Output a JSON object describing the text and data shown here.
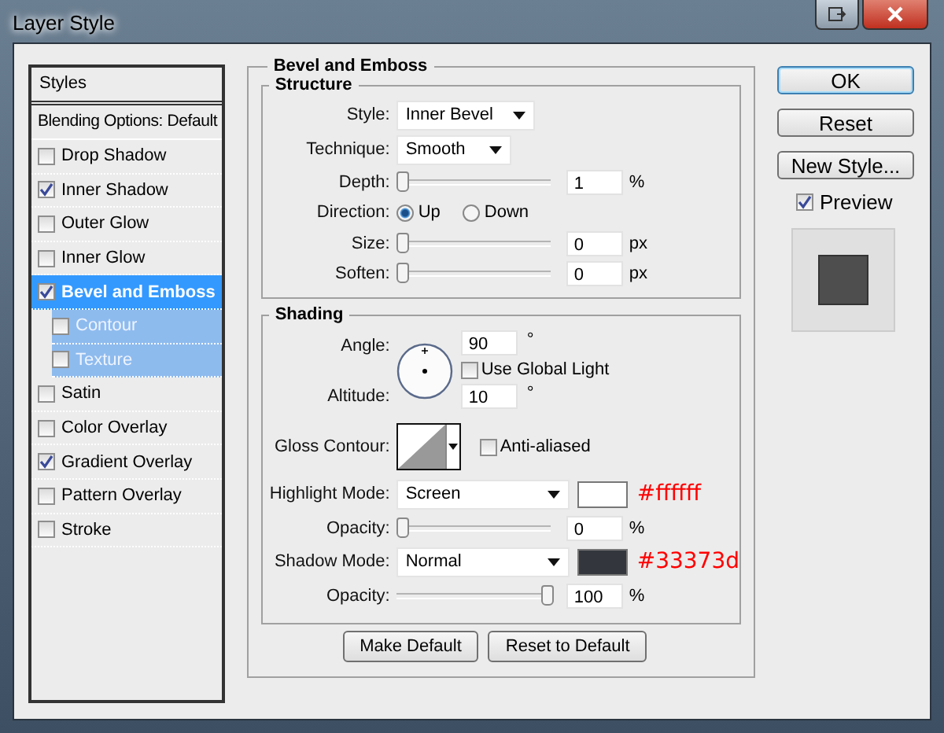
{
  "window": {
    "title": "Layer Style"
  },
  "styles_panel": {
    "header": "Styles",
    "blending_options": "Blending Options: Default",
    "items": [
      {
        "label": "Drop Shadow",
        "checked": false,
        "selected": false
      },
      {
        "label": "Inner Shadow",
        "checked": true,
        "selected": false
      },
      {
        "label": "Outer Glow",
        "checked": false,
        "selected": false
      },
      {
        "label": "Inner Glow",
        "checked": false,
        "selected": false
      },
      {
        "label": "Bevel and Emboss",
        "checked": true,
        "selected": true,
        "children": [
          {
            "label": "Contour",
            "checked": false,
            "selected": false
          },
          {
            "label": "Texture",
            "checked": false,
            "selected": false
          }
        ]
      },
      {
        "label": "Satin",
        "checked": false,
        "selected": false
      },
      {
        "label": "Color Overlay",
        "checked": false,
        "selected": false
      },
      {
        "label": "Gradient Overlay",
        "checked": true,
        "selected": false
      },
      {
        "label": "Pattern Overlay",
        "checked": false,
        "selected": false
      },
      {
        "label": "Stroke",
        "checked": false,
        "selected": false
      }
    ]
  },
  "bevel_and_emboss": {
    "title": "Bevel and Emboss",
    "structure": {
      "title": "Structure",
      "style": {
        "label": "Style:",
        "value": "Inner Bevel"
      },
      "technique": {
        "label": "Technique:",
        "value": "Smooth"
      },
      "depth": {
        "label": "Depth:",
        "level": 0,
        "value": "1",
        "unit": "%"
      },
      "direction": {
        "label": "Direction:",
        "options": [
          {
            "label": "Up",
            "selected": true
          },
          {
            "label": "Down",
            "selected": false
          }
        ]
      },
      "size": {
        "label": "Size:",
        "level": 0,
        "value": "0",
        "unit": "px"
      },
      "soften": {
        "label": "Soften:",
        "level": 0,
        "value": "0",
        "unit": "px"
      }
    },
    "shading": {
      "title": "Shading",
      "angle": {
        "label": "Angle:",
        "value": "90",
        "unit": "°"
      },
      "use_global_light": {
        "label": "Use Global Light",
        "checked": false
      },
      "altitude": {
        "label": "Altitude:",
        "value": "10",
        "unit": "°"
      },
      "gloss_contour": {
        "label": "Gloss Contour:"
      },
      "anti_aliased": {
        "label": "Anti-aliased",
        "checked": false
      },
      "highlight_mode": {
        "label": "Highlight Mode:",
        "value": "Screen",
        "color": "#ffffff",
        "note": "#ffffff"
      },
      "highlight_opacity": {
        "label": "Opacity:",
        "level": 0,
        "value": "0",
        "unit": "%"
      },
      "shadow_mode": {
        "label": "Shadow Mode:",
        "value": "Normal",
        "color": "#33373d",
        "note": "#33373d"
      },
      "shadow_opacity": {
        "label": "Opacity:",
        "level": 1,
        "value": "100",
        "unit": "%"
      }
    },
    "buttons": [
      "Make Default",
      "Reset to Default"
    ]
  },
  "actions": {
    "buttons": [
      {
        "label": "OK",
        "default": true
      },
      {
        "label": "Reset",
        "default": false
      },
      {
        "label": "New Style...",
        "default": false
      }
    ],
    "preview": {
      "label": "Preview",
      "checked": true
    }
  }
}
